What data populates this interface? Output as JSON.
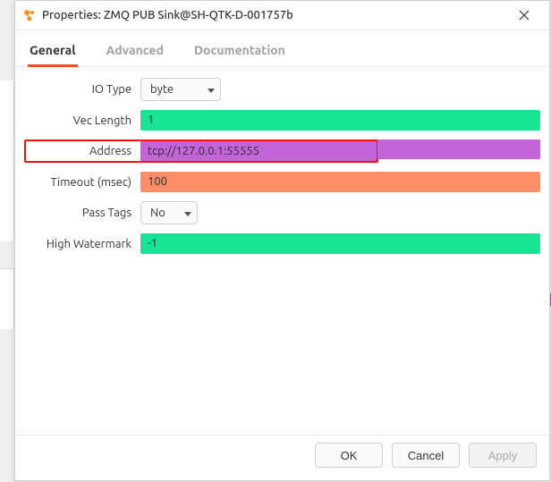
{
  "window": {
    "title": "Properties: ZMQ PUB Sink@SH-QTK-D-001757b"
  },
  "tabs": {
    "general": "General",
    "advanced": "Advanced",
    "documentation": "Documentation"
  },
  "form": {
    "io_type": {
      "label": "IO Type",
      "value": "byte"
    },
    "vec_length": {
      "label": "Vec Length",
      "value": "1"
    },
    "address": {
      "label": "Address",
      "value": "tcp://127.0.0.1:55555"
    },
    "timeout": {
      "label": "Timeout (msec)",
      "value": "100"
    },
    "pass_tags": {
      "label": "Pass Tags",
      "value": "No"
    },
    "high_watermark": {
      "label": "High Watermark",
      "value": "-1"
    }
  },
  "buttons": {
    "ok": "OK",
    "cancel": "Cancel",
    "apply": "Apply"
  }
}
